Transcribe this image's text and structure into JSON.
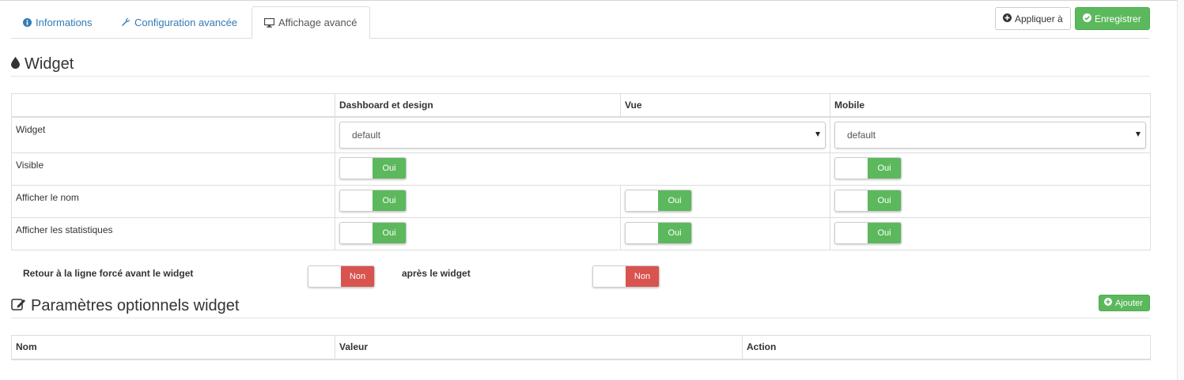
{
  "tabs": [
    {
      "label": "Informations",
      "icon": "info-circle-icon"
    },
    {
      "label": "Configuration avancée",
      "icon": "wrench-icon"
    },
    {
      "label": "Affichage avancé",
      "icon": "desktop-icon"
    }
  ],
  "actions": {
    "apply_label": "Appliquer à",
    "save_label": "Enregistrer"
  },
  "widget_section": {
    "title": "Widget",
    "columns": [
      "",
      "Dashboard et design",
      "Vue",
      "Mobile"
    ],
    "rows": {
      "widget": {
        "label": "Widget",
        "dashboard_select": "default",
        "mobile_select": "default"
      },
      "visible": {
        "label": "Visible",
        "dashboard": "Oui",
        "mobile": "Oui"
      },
      "show_name": {
        "label": "Afficher le nom",
        "dashboard": "Oui",
        "vue": "Oui",
        "mobile": "Oui"
      },
      "show_stats": {
        "label": "Afficher les statistiques",
        "dashboard": "Oui",
        "vue": "Oui",
        "mobile": "Oui"
      }
    }
  },
  "line_break": {
    "before_label": "Retour à la ligne forcé avant le widget",
    "before_value": "Non",
    "after_label": "après le widget",
    "after_value": "Non"
  },
  "optional_params": {
    "title": "Paramètres optionnels widget",
    "add_label": "Ajouter",
    "columns": [
      "Nom",
      "Valeur",
      "Action"
    ]
  },
  "colors": {
    "success": "#5cb85c",
    "danger": "#d9534f",
    "link": "#337ab7"
  }
}
